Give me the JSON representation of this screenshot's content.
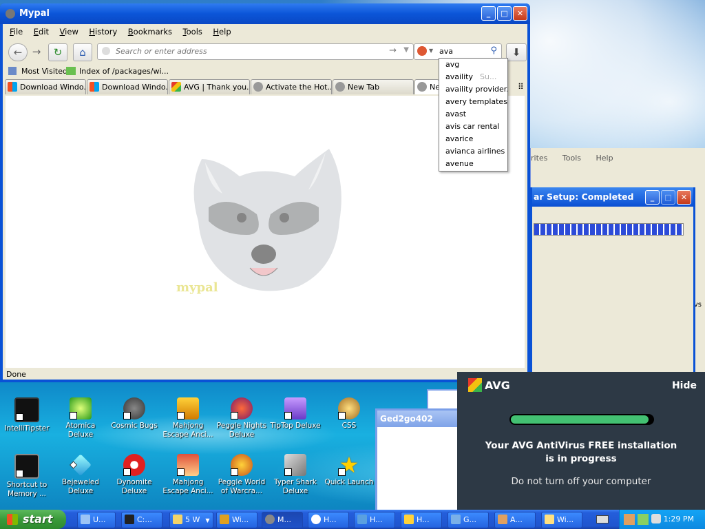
{
  "browser": {
    "title": "Mypal",
    "menu": [
      "File",
      "Edit",
      "View",
      "History",
      "Bookmarks",
      "Tools",
      "Help"
    ],
    "url_placeholder": "Search or enter address",
    "search_value": "ava",
    "bookmarks": [
      "Most Visited",
      "Index of /packages/wi..."
    ],
    "tabs": [
      "Download Windo...",
      "Download Windo...",
      "AVG | Thank you...",
      "Activate the Hot...",
      "New Tab",
      "Ne"
    ],
    "watermark": "mypal",
    "status": "Done"
  },
  "suggestions": [
    "avg",
    "availity",
    "availity provider...",
    "avery templates",
    "avast",
    "avis car rental",
    "avarice",
    "avianca airlines",
    "avenue"
  ],
  "suggestion_hint": "Su...",
  "background_window": {
    "menu": [
      "rites",
      "Tools",
      "Help"
    ],
    "setup_title": "ar Setup: Completed",
    "setup_progress": 1.0,
    "side_text": "vs"
  },
  "ged_window": {
    "title": "Ged2go402"
  },
  "avg_popup": {
    "brand": "AVG",
    "hide": "Hide",
    "progress": 0.97,
    "message": "Your AVG AntiVirus FREE installation is in progress",
    "sub": "Do not turn off your computer"
  },
  "desktop_icons": [
    {
      "label": "IntelliTipster"
    },
    {
      "label": "Atomica Deluxe"
    },
    {
      "label": "Cosmic Bugs"
    },
    {
      "label": "Mahjong Escape Anci..."
    },
    {
      "label": "Peggle Nights Deluxe"
    },
    {
      "label": "TipTop Deluxe"
    },
    {
      "label": "CSS"
    },
    {
      "label": "Shortcut to Memory ..."
    },
    {
      "label": "Bejeweled Deluxe"
    },
    {
      "label": "Dynomite Deluxe"
    },
    {
      "label": "Mahjong Escape Anci..."
    },
    {
      "label": "Peggle World of Warcra..."
    },
    {
      "label": "Typer Shark Deluxe"
    },
    {
      "label": "Quick Launch"
    }
  ],
  "taskbar": {
    "start": "start",
    "buttons": [
      "U...",
      "C:...",
      "5 W",
      "Wi...",
      "M...",
      "H...",
      "H...",
      "H...",
      "G...",
      "A...",
      "Wi..."
    ],
    "clock": "1:29 PM"
  }
}
